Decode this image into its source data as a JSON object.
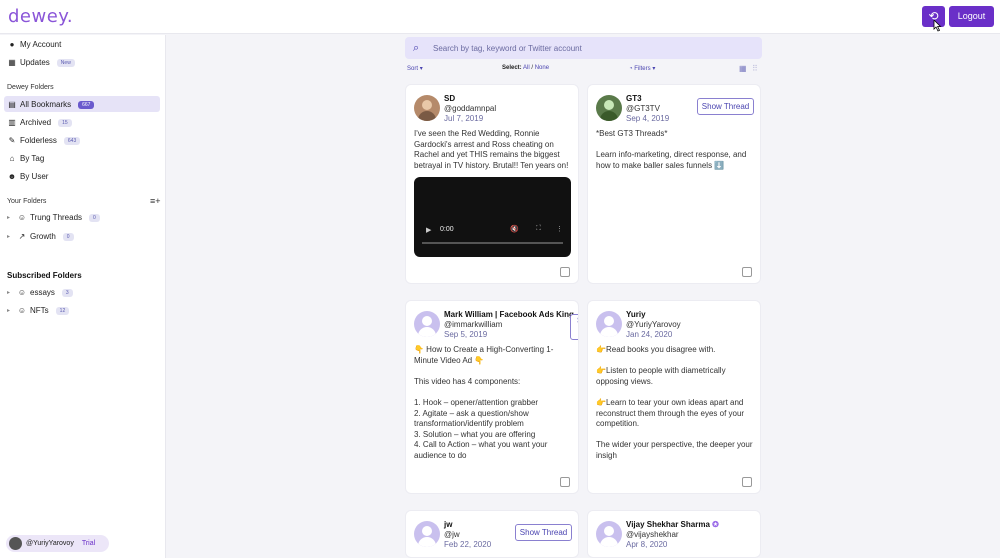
{
  "app": {
    "logo": "dewey.",
    "logout_label": "Logout"
  },
  "sidebar": {
    "top_items": [
      {
        "label": "My Account"
      },
      {
        "label": "Updates",
        "badge": "New"
      }
    ],
    "dewey_folders_heading": "Dewey Folders",
    "folders": [
      {
        "label": "All Bookmarks",
        "badge": "667"
      },
      {
        "label": "Archived",
        "badge": "15"
      },
      {
        "label": "Folderless",
        "badge": "643"
      },
      {
        "label": "By Tag"
      },
      {
        "label": "By User"
      }
    ],
    "your_folders_heading": "Your Folders",
    "your_folders": [
      {
        "label": "Trung Threads",
        "badge": "0"
      },
      {
        "label": "Growth",
        "badge": "0"
      }
    ],
    "subscribed_heading": "Subscribed Folders",
    "subscribed": [
      {
        "label": "essays",
        "badge": "3"
      },
      {
        "label": "NFTs",
        "badge": "12"
      }
    ],
    "user": {
      "handle": "@YuriyYarovoy",
      "plan": "Trial"
    }
  },
  "search": {
    "placeholder": "Search by tag, keyword or Twitter account"
  },
  "controls": {
    "sort": "Sort",
    "select_label": "Select:",
    "select_all": "All",
    "separator": "/",
    "select_none": "None",
    "filters": "Filters"
  },
  "cards": [
    {
      "name": "SD",
      "handle": "@goddamnpal",
      "date": "Jul 7, 2019",
      "text": "I've seen the Red Wedding, Ronnie Gardocki's arrest and Ross cheating on Rachel and yet THIS remains the biggest betrayal in TV history. Brutal!! Ten years on!",
      "video_time": "0:00"
    },
    {
      "name": "GT3",
      "handle": "@GT3TV",
      "date": "Sep 4, 2019",
      "show_thread": "Show Thread",
      "text": "*Best GT3 Threads*\n\nLearn info-marketing, direct response, and how to make baller sales funnels ⬇️"
    },
    {
      "name": "Mark William | Facebook Ads King",
      "handle": "@immarkwilliam",
      "date": "Sep 5, 2019",
      "show_thread": "Show Thread",
      "text": "👇 How to Create a High-Converting 1-Minute Video Ad 👇\n\nThis video has 4 components:\n\n1. Hook – opener/attention grabber\n2. Agitate – ask a question/show transformation/identify problem\n3. Solution – what you are offering\n4. Call to Action – what you want your audience to do"
    },
    {
      "name": "Yuriy",
      "handle": "@YuriyYarovoy",
      "date": "Jan 24, 2020",
      "text": "👉Read books you disagree with.\n\n👉Listen to people with diametrically opposing views.\n\n👉Learn to tear your own ideas apart and reconstruct them through the eyes of your competition.\n\nThe wider your perspective, the deeper your insigh"
    },
    {
      "name": "jw",
      "handle": "@jw",
      "date": "Feb 22, 2020",
      "show_thread": "Show Thread"
    },
    {
      "name": "Vijay Shekhar Sharma",
      "handle": "@vijayshekhar",
      "date": "Apr 8, 2020"
    }
  ],
  "colors": {
    "accent": "#6a2fc8",
    "logo": "#8a55d8",
    "active_bg": "#e6e3f7",
    "search_bg": "#e6e3fa"
  },
  "icons": [
    "refresh-icon",
    "search-icon",
    "user-icon",
    "calendar-icon",
    "bookmark-icon",
    "archive-icon",
    "pin-icon",
    "tag-icon",
    "person-icon",
    "chart-icon",
    "sunglasses-icon",
    "add-list-icon",
    "grid-view-icon",
    "list-view-icon",
    "checkbox-icon",
    "verified-icon"
  ]
}
